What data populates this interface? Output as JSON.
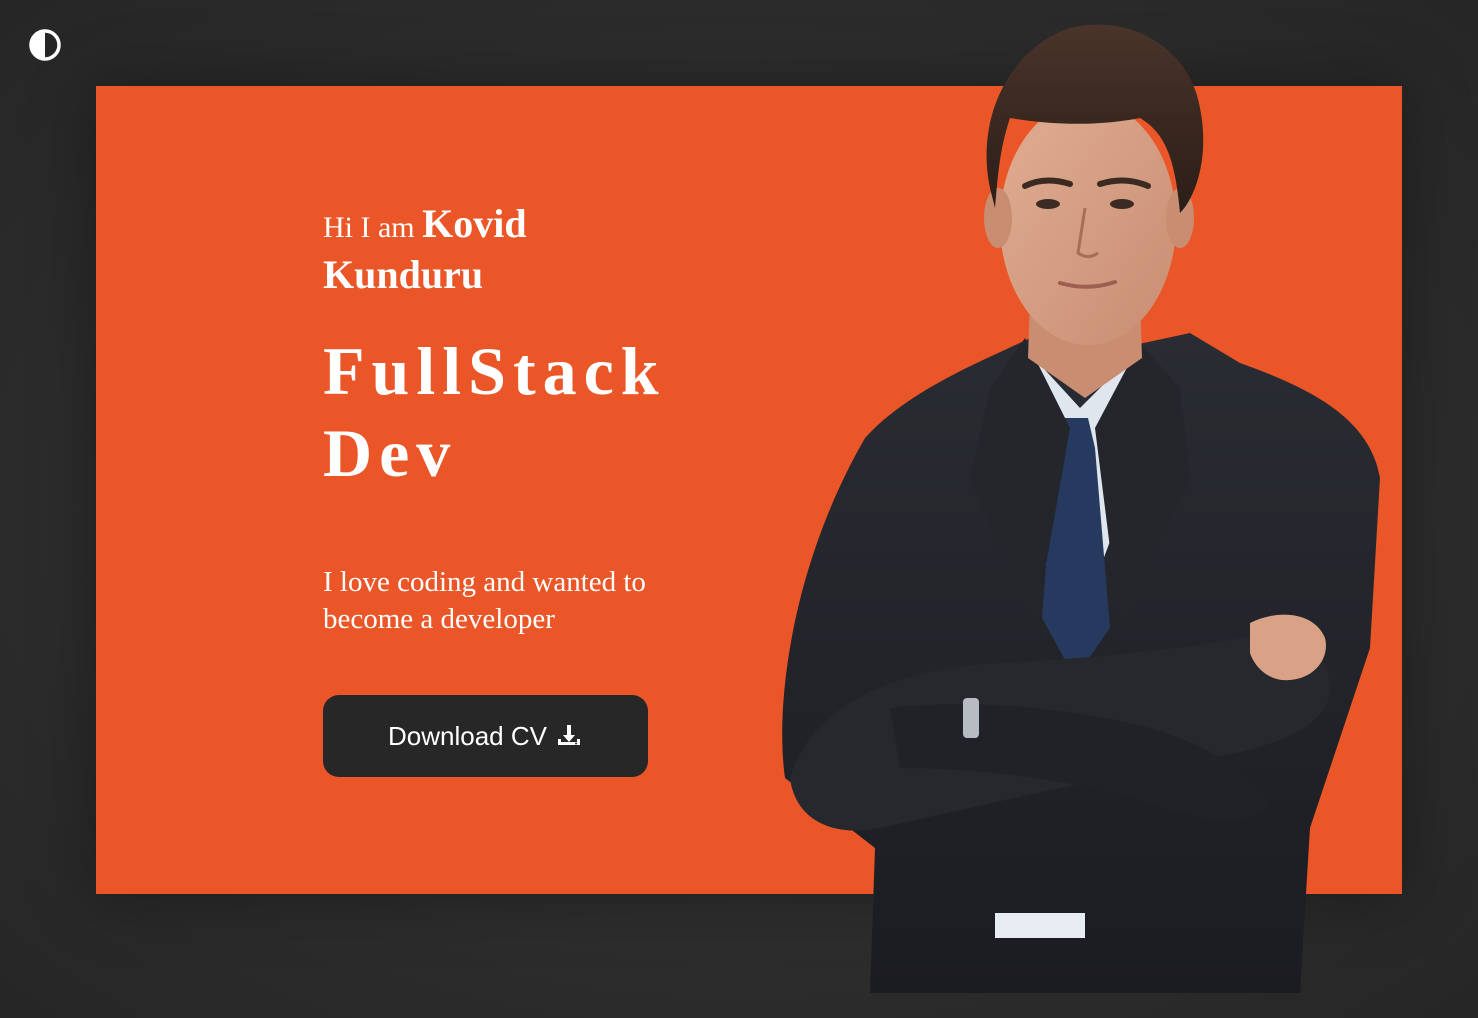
{
  "theme_toggle": {
    "icon": "half-circle-contrast-icon"
  },
  "hero": {
    "greeting_prefix": "Hi I am",
    "name": "Kovid Kunduru",
    "role": "FullStack Dev",
    "intro": "I love coding and wanted to become a developer",
    "download_label": "Download CV",
    "download_icon": "download-icon"
  },
  "colors": {
    "page_background": "#2b2b2b",
    "card_background": "#eb5628",
    "button_background": "#272727",
    "text": "#ffffff"
  }
}
